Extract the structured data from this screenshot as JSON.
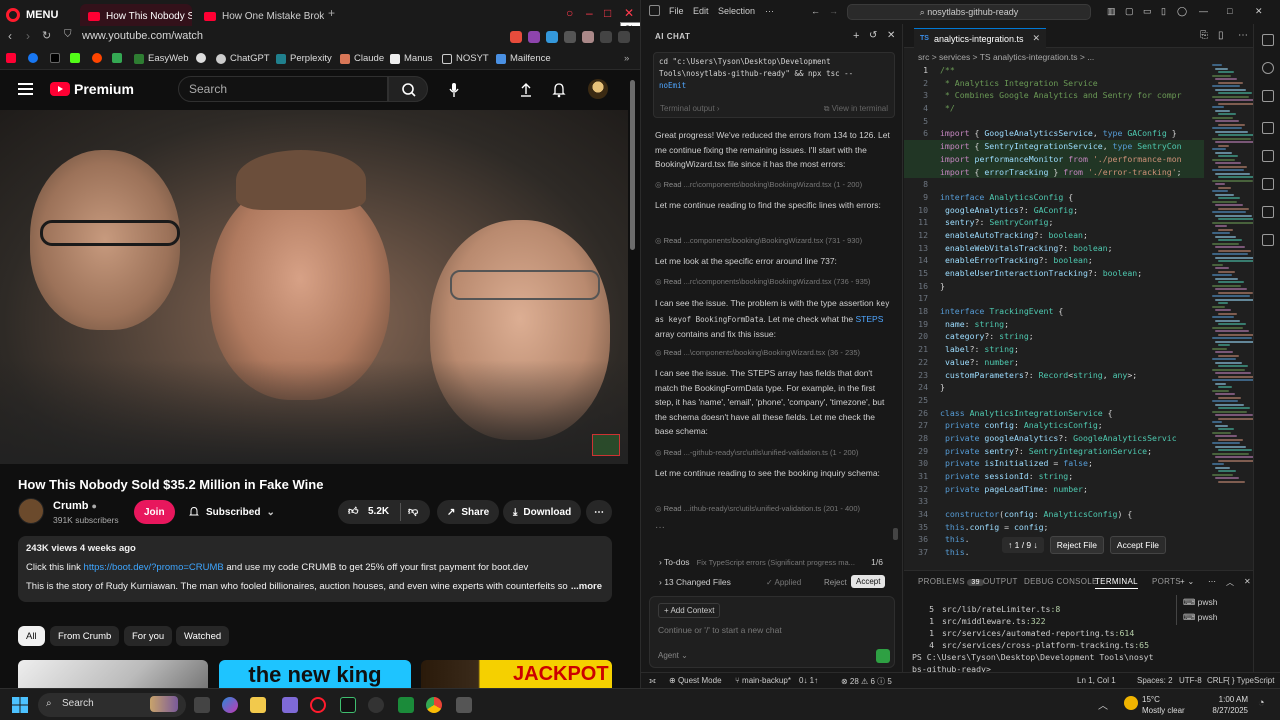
{
  "browser": {
    "menu_label": "MENU",
    "tabs": [
      {
        "label": "How This Nobody Sol",
        "active": true
      },
      {
        "label": "How One Mistake Broke C",
        "active": false
      }
    ],
    "close_tooltip": "Close",
    "url": "www.youtube.com/watch",
    "bookmarks": [
      "EasyWeb",
      "ChatGPT",
      "Perplexity",
      "Claude",
      "Manus",
      "NOSYT",
      "Mailfence"
    ]
  },
  "youtube": {
    "logo_text": "Premium",
    "search_placeholder": "Search",
    "video_title": "How This Nobody Sold $35.2 Million in Fake Wine",
    "channel_name": "Crumb",
    "channel_subs": "391K subscribers",
    "join_label": "Join",
    "subscribed_label": "Subscribed",
    "likes": "5.2K",
    "share_label": "Share",
    "download_label": "Download",
    "desc_meta": "243K views  4 weeks ago",
    "desc_line1_pre": "Click this link ",
    "desc_link": "https://boot.dev/?promo=CRUMB",
    "desc_line1_post": " and use my code  CRUMB  to get 25% off your first payment for boot.dev",
    "desc_line2": "This is the story of Rudy Kurniawan. The man who fooled billionaires, auction houses, and even wine experts with counterfeits so pe",
    "desc_more": "...more",
    "chips": [
      "All",
      "From Crumb",
      "For you",
      "Watched"
    ],
    "thumb_texts": [
      "the new king",
      "JACKPOT"
    ]
  },
  "vscode": {
    "menus": [
      "File",
      "Edit",
      "Selection",
      "···"
    ],
    "command_center": "nosytlabs-github-ready",
    "chat": {
      "header": "AI CHAT",
      "terminal_cmd_lines": [
        "cd \"c:\\Users\\Tyson\\Desktop\\Development",
        "Tools\\nosytlabs-github-ready\" && npx tsc --",
        "noEmit"
      ],
      "terminal_output_label": "Terminal output",
      "view_in_terminal": "View in terminal",
      "msg1": "Great progress! We've reduced the errors from 134 to 126. Let me continue fixing the remaining issues. I'll start with the BookingWizard.tsx file since it has the most errors:",
      "read1": "...rc\\components\\booking\\BookingWizard.tsx (1 - 200)",
      "msg2": "Let me continue reading to find the specific lines with errors:",
      "read2": "...components\\booking\\BookingWizard.tsx (731 - 930)",
      "msg3": "Let me look at the specific error around line 737:",
      "read3": "...rc\\components\\booking\\BookingWizard.tsx (736 - 935)",
      "msg4_a": "I can see the issue. The problem is with the type assertion ",
      "msg4_code": "key as keyof BookingFormData",
      "msg4_b": ". Let me check what the ",
      "msg4_kw": "STEPS",
      "msg4_c": " array contains and fix this issue:",
      "read4": "...\\components\\booking\\BookingWizard.tsx (36 - 235)",
      "msg5": "I can see the issue. The STEPS array has fields that don't match the BookingFormData type. For example, in the first step, it has 'name', 'email', 'phone', 'company', 'timezone', but the schema doesn't have all these fields. Let me check the base schema:",
      "read5": "...-github-ready\\src\\utils\\unified-validation.ts (1 - 200)",
      "msg6": "Let me continue reading to see the booking inquiry schema:",
      "read6": "...ithub-ready\\src\\utils\\unified-validation.ts (201 - 400)",
      "read_prefix": "Read",
      "todos_label": "To-dos",
      "todos_desc": "Fix TypeScript errors (Significant progress ma...",
      "todos_count": "1/6",
      "changed_files": "13 Changed Files",
      "applied": "Applied",
      "reject": "Reject",
      "accept": "Accept",
      "add_context": "+ Add Context",
      "input_placeholder": "Continue or '/' to start a new chat",
      "agent_label": "Agent"
    },
    "editor": {
      "tab_name": "analytics-integration.ts",
      "breadcrumb": "src > services > TS analytics-integration.ts > ...",
      "diff_nav": "↑ 1 / 9 ↓",
      "reject_file": "Reject File",
      "accept_file": "Accept File",
      "lines": [
        {
          "n": "1",
          "html": "<span class='cm'>/**</span>"
        },
        {
          "n": "2",
          "html": "<span class='cm'> * Analytics Integration Service</span>"
        },
        {
          "n": "3",
          "html": "<span class='cm'> * Combines Google Analytics and Sentry for compr</span>"
        },
        {
          "n": "4",
          "html": "<span class='cm'> */</span>"
        },
        {
          "n": "5",
          "html": ""
        },
        {
          "n": "6",
          "html": "<span class='kw2'>import</span> { <span class='pr'>GoogleAnalyticsService</span>, <span class='kw'>type</span> <span class='ty'>GAConfig</span> }"
        },
        {
          "n": "",
          "html": "<span class='kw2'>import</span> { <span class='pr'>SentryIntegrationService</span>, <span class='kw'>type</span> <span class='ty'>SentryCon</span>"
        },
        {
          "n": "",
          "html": "<span class='kw2'>import</span> <span class='pr'>performanceMonitor</span> <span class='kw2'>from</span> <span class='st'>'./performance-mon</span>"
        },
        {
          "n": "",
          "html": "<span class='kw2'>import</span> { <span class='pr'>errorTracking</span> } <span class='kw2'>from</span> <span class='st'>'./error-tracking'</span>;"
        },
        {
          "n": "8",
          "html": ""
        },
        {
          "n": "9",
          "html": "<span class='kw'>interface</span> <span class='ty'>AnalyticsConfig</span> {"
        },
        {
          "n": "10",
          "html": "  <span class='pr'>googleAnalytics</span>?: <span class='ty'>GAConfig</span>;"
        },
        {
          "n": "11",
          "html": "  <span class='pr'>sentry</span>?: <span class='ty'>SentryConfig</span>;"
        },
        {
          "n": "12",
          "html": "  <span class='pr'>enableAutoTracking</span>?: <span class='ty'>boolean</span>;"
        },
        {
          "n": "13",
          "html": "  <span class='pr'>enableWebVitalsTracking</span>?: <span class='ty'>boolean</span>;"
        },
        {
          "n": "14",
          "html": "  <span class='pr'>enableErrorTracking</span>?: <span class='ty'>boolean</span>;"
        },
        {
          "n": "15",
          "html": "  <span class='pr'>enableUserInteractionTracking</span>?: <span class='ty'>boolean</span>;"
        },
        {
          "n": "16",
          "html": "}"
        },
        {
          "n": "17",
          "html": ""
        },
        {
          "n": "18",
          "html": "<span class='kw'>interface</span> <span class='ty'>TrackingEvent</span> {"
        },
        {
          "n": "19",
          "html": "  <span class='pr'>name</span>: <span class='ty'>string</span>;"
        },
        {
          "n": "20",
          "html": "  <span class='pr'>category</span>?: <span class='ty'>string</span>;"
        },
        {
          "n": "21",
          "html": "  <span class='pr'>label</span>?: <span class='ty'>string</span>;"
        },
        {
          "n": "22",
          "html": "  <span class='pr'>value</span>?: <span class='ty'>number</span>;"
        },
        {
          "n": "23",
          "html": "  <span class='pr'>customParameters</span>?: <span class='ty'>Record</span>&lt;<span class='ty'>string</span>, <span class='ty'>any</span>&gt;;"
        },
        {
          "n": "24",
          "html": "}"
        },
        {
          "n": "25",
          "html": ""
        },
        {
          "n": "26",
          "html": "<span class='kw'>class</span> <span class='ty'>AnalyticsIntegrationService</span> {"
        },
        {
          "n": "27",
          "html": "  <span class='kw'>private</span> <span class='pr'>config</span>: <span class='ty'>AnalyticsConfig</span>;"
        },
        {
          "n": "28",
          "html": "  <span class='kw'>private</span> <span class='pr'>googleAnalytics</span>?: <span class='ty'>GoogleAnalyticsServic</span>"
        },
        {
          "n": "29",
          "html": "  <span class='kw'>private</span> <span class='pr'>sentry</span>?: <span class='ty'>SentryIntegrationService</span>;"
        },
        {
          "n": "30",
          "html": "  <span class='kw'>private</span> <span class='pr'>isInitialized</span> = <span class='kw'>false</span>;"
        },
        {
          "n": "31",
          "html": "  <span class='kw'>private</span> <span class='pr'>sessionId</span>: <span class='ty'>string</span>;"
        },
        {
          "n": "32",
          "html": "  <span class='kw'>private</span> <span class='pr'>pageLoadTime</span>: <span class='ty'>number</span>;"
        },
        {
          "n": "33",
          "html": ""
        },
        {
          "n": "34",
          "html": "  <span class='kw'>constructor</span>(<span class='pr'>config</span>: <span class='ty'>AnalyticsConfig</span>) {"
        },
        {
          "n": "35",
          "html": "    <span class='kw'>this</span>.<span class='pr'>config</span> = <span class='pr'>config</span>;"
        },
        {
          "n": "36",
          "html": "    <span class='kw'>this</span>."
        },
        {
          "n": "37",
          "html": "    <span class='kw'>this</span>."
        }
      ]
    },
    "panel": {
      "tabs": [
        "PROBLEMS",
        "OUTPUT",
        "DEBUG CONSOLE",
        "TERMINAL",
        "PORTS"
      ],
      "problems_count": "39",
      "terminal_lines": [
        {
          "n": "5",
          "path": "src/lib/rateLimiter.ts",
          "col": ":8"
        },
        {
          "n": "1",
          "path": "src/middleware.ts",
          "col": ":322"
        },
        {
          "n": "1",
          "path": "src/services/automated-reporting.ts",
          "col": ":614"
        },
        {
          "n": "4",
          "path": "src/services/cross-platform-tracking.ts",
          "col": ":65"
        }
      ],
      "prompt_line1": "PS C:\\Users\\Tyson\\Desktop\\Development Tools\\nosyt",
      "prompt_line2": "bs-github-ready>",
      "terminals": [
        "pwsh",
        "pwsh"
      ]
    },
    "status": {
      "quest": "Quest Mode",
      "branch": "main-backup*",
      "sync": "0↓ 1↑",
      "problems": "⊗ 28 ⚠ 6 ⓘ 5",
      "position": "Ln 1, Col 1",
      "spaces": "Spaces: 2",
      "encoding": "UTF-8",
      "eol": "CRLF",
      "lang": "{ } TypeScript"
    }
  },
  "taskbar": {
    "search": "Search",
    "weather_temp": "15°C",
    "weather_desc": "Mostly clear",
    "time": "1:00 AM",
    "date": "8/27/2025"
  },
  "colors": {
    "opera_red": "#ff1b2d",
    "youtube_red": "#ff0033",
    "vscode_accent": "#0078d4"
  }
}
